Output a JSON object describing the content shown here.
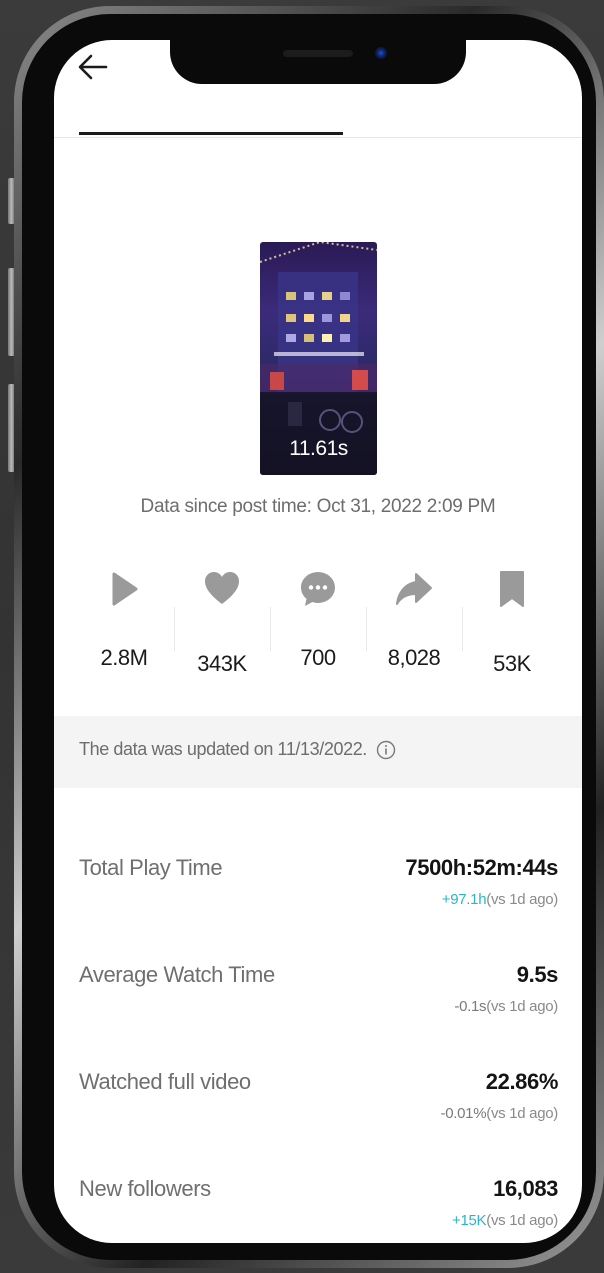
{
  "video": {
    "duration": "11.61s"
  },
  "post_time": "Data since post time: Oct 31, 2022 2:09 PM",
  "stats": [
    {
      "icon": "play-icon",
      "value": "2.8M"
    },
    {
      "icon": "heart-icon",
      "value": "343K"
    },
    {
      "icon": "comment-icon",
      "value": "700"
    },
    {
      "icon": "share-icon",
      "value": "8,028"
    },
    {
      "icon": "bookmark-icon",
      "value": "53K"
    }
  ],
  "updated_notice": "The data was updated on 11/13/2022.",
  "metrics": [
    {
      "label": "Total Play Time",
      "value": "7500h:52m:44s",
      "change": "+97.1h",
      "comparison": "(vs 1d ago)"
    },
    {
      "label": "Average Watch Time",
      "value": "9.5s",
      "change": "-0.1s",
      "comparison": "(vs 1d ago)"
    },
    {
      "label": "Watched full video",
      "value": "22.86%",
      "change": "-0.01%",
      "comparison": "(vs 1d ago)"
    },
    {
      "label": "New followers",
      "value": "16,083",
      "change": "+15K",
      "comparison": "(vs 1d ago)"
    }
  ],
  "colors": {
    "positive": "#2bb5c5",
    "icon_gray": "#9a9a9a",
    "text_primary": "#141414",
    "text_secondary": "#6f6f6f"
  }
}
